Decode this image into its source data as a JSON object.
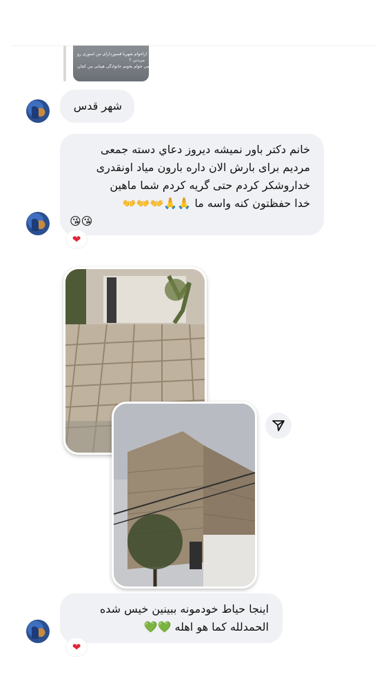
{
  "shared_post": {
    "lines": [
      "ازاحوام شهریا قصوردارای من امنوری رو",
      "می‌دنی ؟",
      "می خوام بخونم جانوادگی هیبانی من کجان"
    ]
  },
  "messages": [
    {
      "id": "msg1",
      "lines": [
        "شهر قدس"
      ]
    },
    {
      "id": "msg2",
      "lines": [
        "خانم دکتر باور نمیشه دیروز دعاي دسته جمعی",
        "مردیم برای بارش الان داره بارون میاد اونقدری",
        "خداروشکر کردم حتی گریه کردم شما ماهین",
        "خدا حفظتون کنه واسه ما 🙏🙏👐👐👐",
        "😘😘"
      ],
      "reaction": "❤"
    },
    {
      "id": "msg3",
      "lines": [
        "اینجا حیاط خودمونه ببینین خیس شده",
        "الحمدلله كما هو اهله 💚💚"
      ],
      "reaction": "❤"
    }
  ],
  "icons": {
    "share": "paper-plane-icon",
    "reaction": "heart-icon"
  },
  "colors": {
    "bubble": "#f0f1f4",
    "heart": "#e2243a",
    "background": "#ffffff"
  }
}
